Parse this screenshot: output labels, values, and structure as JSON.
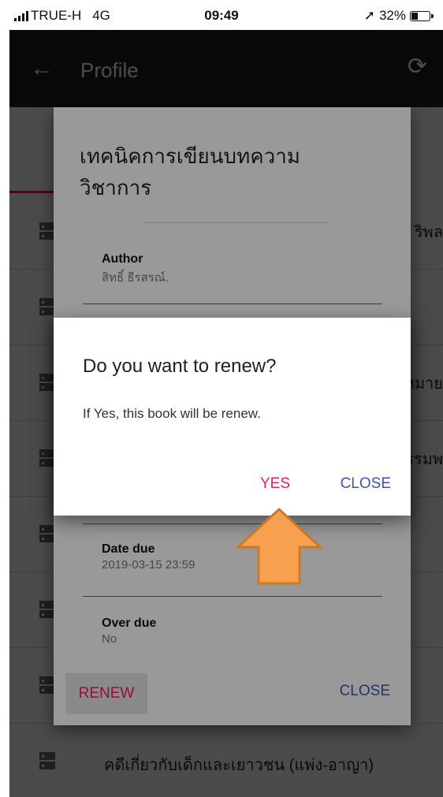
{
  "status_bar": {
    "carrier": "TRUE-H",
    "network": "4G",
    "time": "09:49",
    "battery": "32%",
    "battery_level": 0.32
  },
  "app_bar": {
    "title": "Profile",
    "back_icon": "arrow-left-icon",
    "refresh_icon": "refresh-icon"
  },
  "list": {
    "items": [
      {
        "label": "ริพล"
      },
      {
        "label": ""
      },
      {
        "label": "หมาย"
      },
      {
        "label": "รรมพ"
      },
      {
        "label": ""
      },
      {
        "label": ""
      },
      {
        "label": ""
      },
      {
        "label": "คดีเกี่ยวกับเด็กและเยาวชน (แพ่ง-อาญา)"
      }
    ]
  },
  "book_dialog": {
    "title": "เทคนิคการเขียนบทความวิชาการ",
    "author_label": "Author",
    "author_value": "สิทธิ์ ธีรสรณ์.",
    "date_due_label": "Date due",
    "date_due_value": "2019-03-15 23:59",
    "over_due_label": "Over due",
    "over_due_value": "No",
    "renew_label": "RENEW",
    "close_label": "CLOSE"
  },
  "confirm_dialog": {
    "title": "Do you want to renew?",
    "message": "If Yes, this book will be renew.",
    "yes_label": "YES",
    "close_label": "CLOSE"
  },
  "colors": {
    "accent_pink": "#e91e63",
    "accent_indigo": "#3f51b5",
    "app_bar": "#212121",
    "arrow_fill": "#f7a04f",
    "arrow_stroke": "#c97a2a"
  }
}
